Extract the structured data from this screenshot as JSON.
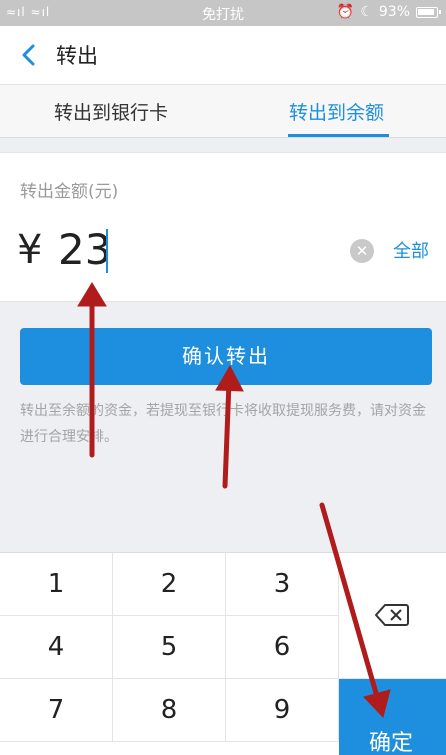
{
  "status_bar": {
    "signal": "≈ıl ≈ıl",
    "mode": "免打扰",
    "battery": "93%"
  },
  "header": {
    "title": "转出"
  },
  "tabs": [
    {
      "label": "转出到银行卡",
      "active": false
    },
    {
      "label": "转出到余额",
      "active": true
    }
  ],
  "amount": {
    "label": "转出金额(元)",
    "currency": "¥",
    "value": "23",
    "all_label": "全部"
  },
  "confirm_label": "确认转出",
  "notice": "转出至余额的资金，若提现至银行卡将收取提现服务费，请对资金进行合理安排。",
  "keypad": {
    "keys": [
      "1",
      "2",
      "3",
      "4",
      "5",
      "6",
      "7",
      "8",
      "9"
    ],
    "ok_label": "确定"
  },
  "colors": {
    "accent": "#1e8fde",
    "annotation_arrow": "#b01c1c"
  },
  "icons": [
    "back-arrow-icon",
    "wifi-icon",
    "alarm-icon",
    "moon-icon",
    "battery-icon",
    "clear-icon",
    "backspace-icon"
  ]
}
